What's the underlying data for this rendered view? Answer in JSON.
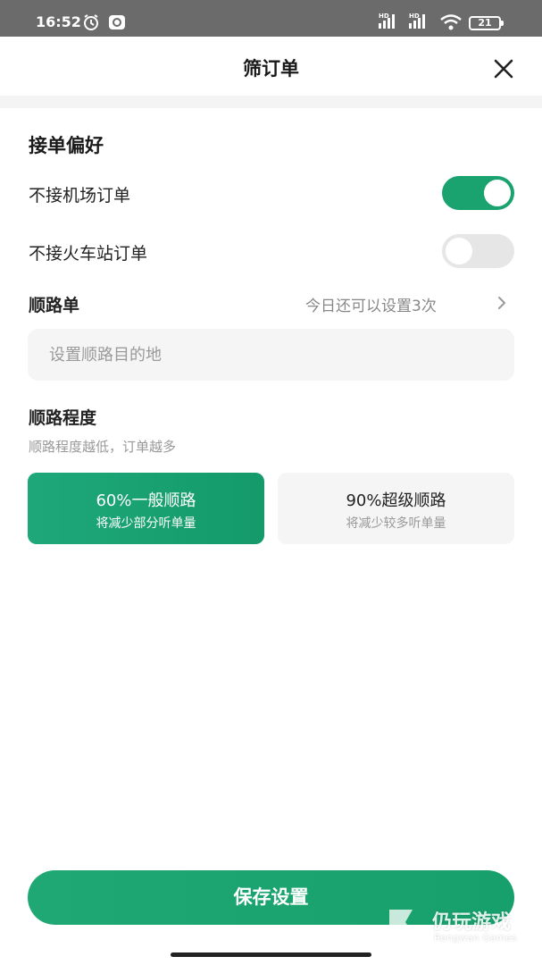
{
  "status_bar": {
    "time": "16:52",
    "battery": "21",
    "network_1": "HD",
    "network_2": "HD",
    "icons": [
      "alarm-icon",
      "app-notification-icon",
      "signal-icon",
      "signal-icon",
      "wifi-icon",
      "battery-icon"
    ]
  },
  "header": {
    "title": "筛订单",
    "close_icon": "close-icon"
  },
  "preferences": {
    "title": "接单偏好",
    "items": [
      {
        "label": "不接机场订单",
        "enabled": true
      },
      {
        "label": "不接火车站订单",
        "enabled": false
      }
    ]
  },
  "route": {
    "label": "顺路单",
    "remaining_text": "今日还可以设置3次",
    "destination_placeholder": "设置顺路目的地",
    "destination_value": ""
  },
  "route_degree": {
    "title": "顺路程度",
    "hint": "顺路程度越低，订单越多",
    "options": [
      {
        "title": "60%一般顺路",
        "subtitle": "将减少部分听单量",
        "selected": true
      },
      {
        "title": "90%超级顺路",
        "subtitle": "将减少较多听单量",
        "selected": false
      }
    ]
  },
  "footer": {
    "save_label": "保存设置"
  },
  "watermark": {
    "text": "仍玩游戏",
    "sub": "Rengwan Games"
  },
  "colors": {
    "accent": "#1aa36f",
    "toggle_off": "#e6e6e6",
    "status_bar": "#6b6b6b"
  }
}
